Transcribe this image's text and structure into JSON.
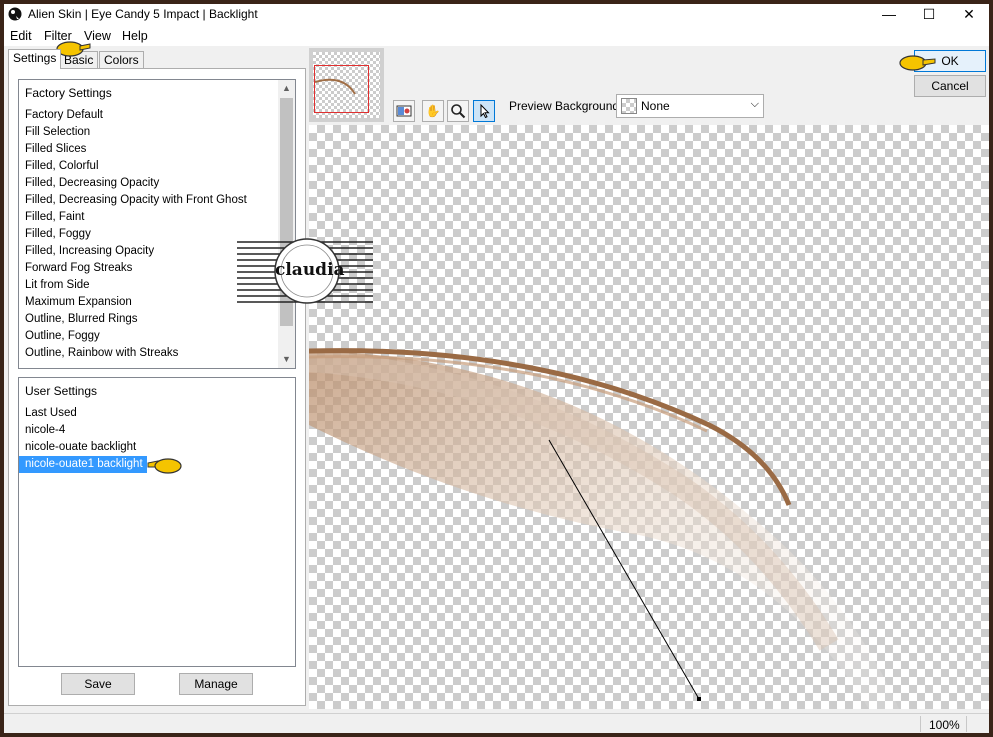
{
  "window": {
    "title": "Alien Skin | Eye Candy 5 Impact | Backlight",
    "minimize": "—",
    "maximize": "☐",
    "close": "✕"
  },
  "menu": [
    "Edit",
    "Filter",
    "View",
    "Help"
  ],
  "tabs": [
    "Settings",
    "Basic",
    "Colors"
  ],
  "factory_settings": {
    "header": "Factory Settings",
    "items": [
      "Factory Default",
      "Fill Selection",
      "Filled Slices",
      "Filled, Colorful",
      "Filled, Decreasing Opacity",
      "Filled, Decreasing Opacity with Front Ghost",
      "Filled, Faint",
      "Filled, Foggy",
      "Filled, Increasing Opacity",
      "Forward Fog Streaks",
      "Lit from Side",
      "Maximum Expansion",
      "Outline, Blurred Rings",
      "Outline, Foggy",
      "Outline, Rainbow with Streaks"
    ]
  },
  "user_settings": {
    "header": "User Settings",
    "items": [
      "Last Used",
      "nicole-4",
      "nicole-ouate backlight",
      "nicole-ouate1 backlight"
    ],
    "selected": "nicole-ouate1 backlight"
  },
  "buttons": {
    "save": "Save",
    "manage": "Manage",
    "ok": "OK",
    "cancel": "Cancel"
  },
  "preview_background": {
    "label": "Preview Background:",
    "value": "None"
  },
  "tools": {
    "preview_toggle": "preview-toggle-icon",
    "hand": "hand-icon",
    "zoom": "magnifier-icon",
    "pointer": "arrow-pointer-icon"
  },
  "watermark_text": "claudia",
  "status": {
    "zoom": "100%"
  },
  "colors": {
    "selection": "#3399ff",
    "feather": "#a06e46",
    "pointer_hand": "#f5c400"
  }
}
